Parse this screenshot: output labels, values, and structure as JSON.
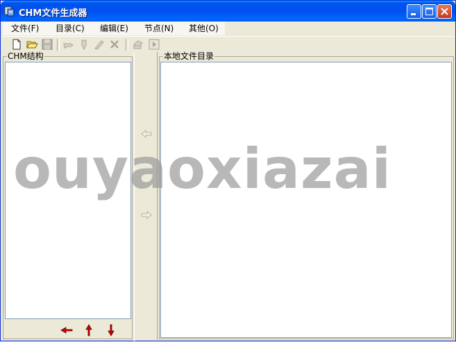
{
  "window": {
    "title": "CHM文件生成器"
  },
  "menu": [
    {
      "label": "文件(F)"
    },
    {
      "label": "目录(C)"
    },
    {
      "label": "编辑(E)"
    },
    {
      "label": "节点(N)"
    },
    {
      "label": "其他(O)"
    }
  ],
  "toolbar": {
    "icons": [
      "new-file-icon",
      "open-folder-icon",
      "save-icon",
      "hand-point-icon",
      "pen-icon",
      "edit-brush-icon",
      "delete-x-icon",
      "print-icon",
      "run-icon"
    ],
    "enabled": [
      true,
      true,
      false,
      false,
      false,
      false,
      false,
      false,
      false
    ]
  },
  "left_panel": {
    "label": "CHM结构"
  },
  "right_panel": {
    "label": "本地文件目录"
  },
  "transfer": {
    "left_icon": "arrow-left-icon",
    "right_icon": "arrow-right-icon"
  },
  "nav_arrows": [
    "arrow-left-red-icon",
    "arrow-up-red-icon",
    "arrow-down-red-icon"
  ],
  "watermark": {
    "text": "ouyaoxiazai"
  },
  "colors": {
    "titlebar": "#0054E3",
    "accent_red": "#CC0000",
    "panel_border": "#7F9DB9",
    "face": "#ECE9D8"
  }
}
